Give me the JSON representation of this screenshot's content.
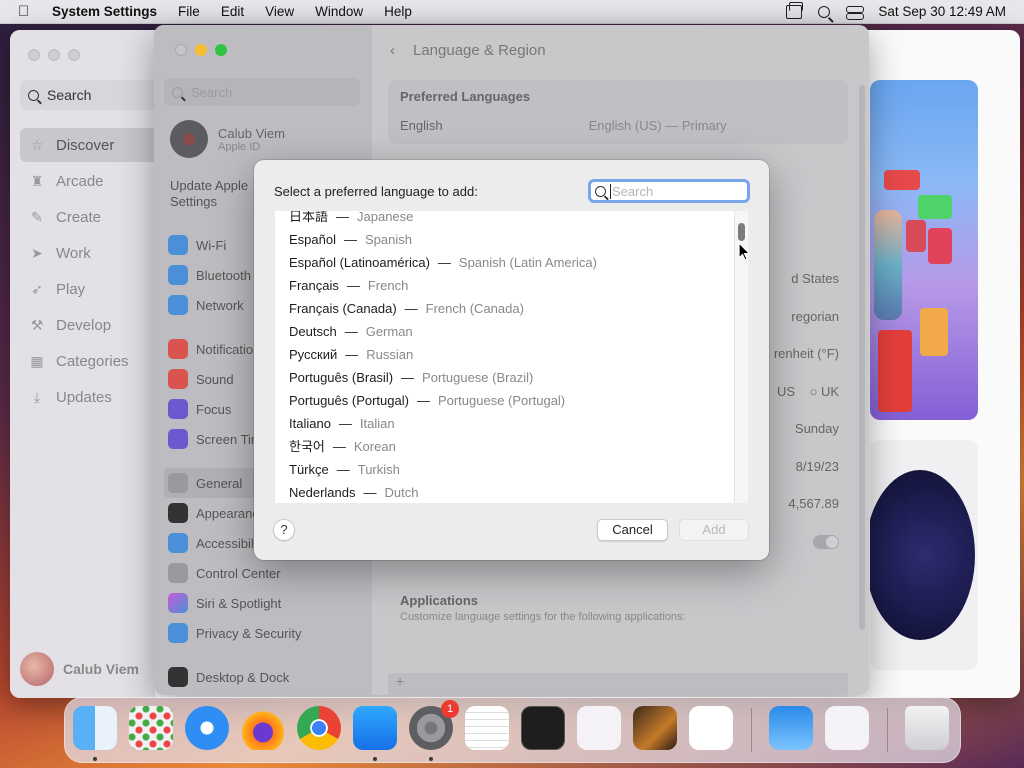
{
  "menubar": {
    "app_name": "System Settings",
    "menus": [
      "File",
      "Edit",
      "View",
      "Window",
      "Help"
    ],
    "clock": "Sat Sep 30  12:49 AM"
  },
  "appstore": {
    "search_label": "Search",
    "nav": [
      "Discover",
      "Arcade",
      "Create",
      "Work",
      "Play",
      "Develop",
      "Categories",
      "Updates"
    ],
    "user_name": "Calub Viem"
  },
  "settings": {
    "search_placeholder": "Search",
    "user_name": "Calub Viem",
    "user_sub": "Apple ID",
    "update_text": "Update Apple Settings",
    "sidebar_group1": [
      "Wi-Fi",
      "Bluetooth",
      "Network"
    ],
    "sidebar_group2": [
      "Notifications",
      "Sound",
      "Focus",
      "Screen Time"
    ],
    "sidebar_group3": [
      "General",
      "Appearance",
      "Accessibility",
      "Control Center",
      "Siri & Spotlight",
      "Privacy & Security"
    ],
    "sidebar_group4": [
      "Desktop & Dock"
    ],
    "page_title": "Language & Region",
    "preferred_title": "Preferred Languages",
    "pref_lang": "English",
    "pref_lang_value": "English (US) — Primary",
    "region_value": "d States",
    "calendar_value": "regorian",
    "temp_value": "renheit (°F)",
    "measure_us": "US",
    "measure_uk": "UK",
    "first_day": "Sunday",
    "date_format": "8/19/23",
    "number_format": "4,567.89",
    "apps_title": "Applications",
    "apps_desc": "Customize language settings for the following applications:",
    "plus": "+"
  },
  "sheet": {
    "prompt": "Select a preferred language to add:",
    "search_placeholder": "Search",
    "languages": [
      {
        "native": "日本語",
        "english": "Japanese"
      },
      {
        "native": "Español",
        "english": "Spanish"
      },
      {
        "native": "Español (Latinoamérica)",
        "english": "Spanish (Latin America)"
      },
      {
        "native": "Français",
        "english": "French"
      },
      {
        "native": "Français (Canada)",
        "english": "French (Canada)"
      },
      {
        "native": "Deutsch",
        "english": "German"
      },
      {
        "native": "Русский",
        "english": "Russian"
      },
      {
        "native": "Português (Brasil)",
        "english": "Portuguese (Brazil)"
      },
      {
        "native": "Português (Portugal)",
        "english": "Portuguese (Portugal)"
      },
      {
        "native": "Italiano",
        "english": "Italian"
      },
      {
        "native": "한국어",
        "english": "Korean"
      },
      {
        "native": "Türkçe",
        "english": "Turkish"
      },
      {
        "native": "Nederlands",
        "english": "Dutch"
      }
    ],
    "separator": "—",
    "help_label": "?",
    "cancel_label": "Cancel",
    "add_label": "Add"
  },
  "dock": {
    "badge_count": "1",
    "apps": [
      "Finder",
      "Launchpad",
      "Safari",
      "Firefox",
      "Chrome",
      "App Store",
      "System Settings",
      "TextEdit",
      "Terminal",
      "Visual Studio",
      "GarageBand",
      "VS Code",
      "Weather",
      "Visual Studio",
      "Trash"
    ]
  },
  "colors": {
    "accent": "#79a6ea",
    "badge": "#ec3b30"
  }
}
